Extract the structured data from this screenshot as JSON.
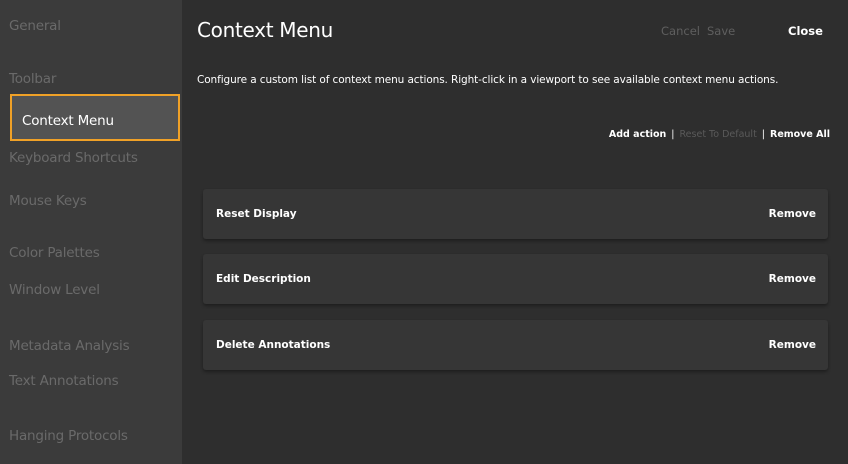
{
  "sidebar": {
    "items": [
      {
        "label": "General"
      },
      {
        "label": "Toolbar"
      },
      {
        "label": "Context Menu"
      },
      {
        "label": "Keyboard Shortcuts"
      },
      {
        "label": "Mouse Keys"
      },
      {
        "label": "Color Palettes"
      },
      {
        "label": "Window Level"
      },
      {
        "label": "Metadata Analysis"
      },
      {
        "label": "Text Annotations"
      },
      {
        "label": "Hanging Protocols"
      }
    ],
    "active_label": "Context Menu"
  },
  "header": {
    "title": "Context Menu",
    "cancel_label": "Cancel",
    "save_label": "Save",
    "close_label": "Close"
  },
  "description": "Configure a custom list of context menu actions. Right-click in a viewport to see available context menu actions.",
  "toolbar": {
    "add_action_label": "Add action",
    "reset_label": "Reset To Default",
    "remove_all_label": "Remove All",
    "separator": "|"
  },
  "actions": [
    {
      "label": "Reset Display",
      "remove_label": "Remove"
    },
    {
      "label": "Edit Description",
      "remove_label": "Remove"
    },
    {
      "label": "Delete Annotations",
      "remove_label": "Remove"
    }
  ],
  "colors": {
    "accent_border": "#f0a127",
    "sidebar_bg": "#3b3b3b",
    "main_bg": "#2e2e2e"
  }
}
